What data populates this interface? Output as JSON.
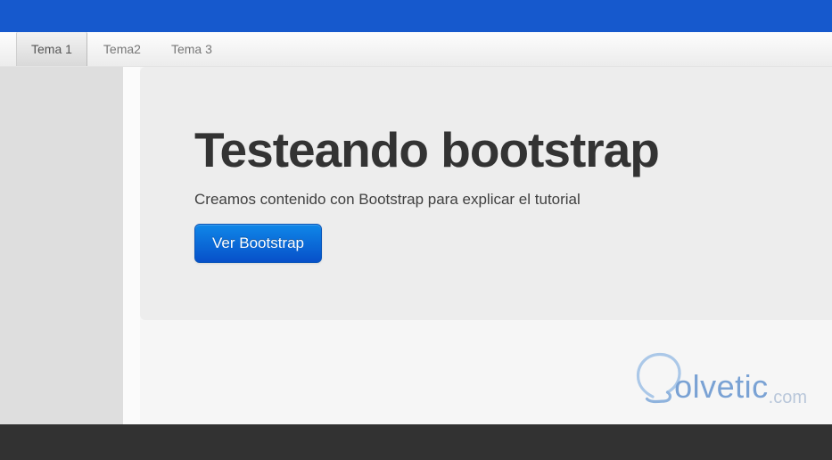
{
  "topbar": {
    "bg_color": "#1659cd"
  },
  "tabs": [
    {
      "label": "Tema 1",
      "active": true
    },
    {
      "label": "Tema2",
      "active": false
    },
    {
      "label": "Tema 3",
      "active": false
    }
  ],
  "hero": {
    "title": "Testeando bootstrap",
    "subtitle": "Creamos contenido con Bootstrap para explicar el tutorial",
    "button_label": "Ver Bootstrap",
    "bg_color": "#ededed",
    "button_color_top": "#0f87e8",
    "button_color_bottom": "#0750c9"
  },
  "logo": {
    "icon": "lightbulb-icon",
    "text": "olvetic",
    "tld": ".com",
    "text_color": "#7aa2d4",
    "tld_color": "#b9c7da"
  },
  "footer": {
    "bg_color": "#323232"
  },
  "sidebar": {
    "bg_color": "#dedede"
  }
}
